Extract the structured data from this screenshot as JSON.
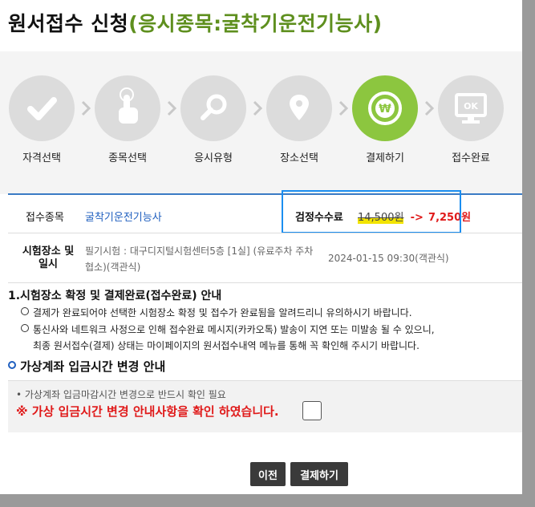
{
  "title": {
    "main": "원서접수 신청",
    "sub": "(응시종목:굴착기운전기능사)"
  },
  "steps": [
    {
      "label": "자격선택",
      "icon": "check-icon",
      "state": "done"
    },
    {
      "label": "종목선택",
      "icon": "hand-pointer-icon",
      "state": "done"
    },
    {
      "label": "응시유형",
      "icon": "magnifier-icon",
      "state": "done"
    },
    {
      "label": "장소선택",
      "icon": "map-pin-icon",
      "state": "done"
    },
    {
      "label": "결제하기",
      "icon": "won-coin-icon",
      "state": "active"
    },
    {
      "label": "접수완료",
      "icon": "monitor-ok-icon",
      "state": "pending"
    }
  ],
  "monitor_ok_text": "OK",
  "exam_info": {
    "subject_label": "접수종목",
    "subject_value": "굴착기운전기능사",
    "fee_label": "검정수수료",
    "fee_original": "14,500원",
    "fee_arrow": "->",
    "fee_discounted": "7,250원",
    "place_label_line1": "시험장소 및",
    "place_label_line2": "일시",
    "place_value_line1": "필기시험 : 대구디지털시험센터5층 [1실] (유료주차 주차",
    "place_value_line2": "협소)(객관식)",
    "datetime": "2024-01-15 09:30(객관식)"
  },
  "notice": {
    "title": "1.시험장소 확정 및 결제완료(접수완료) 안내",
    "item1": "결제가 완료되어야 선택한 시험장소 확정 및 접수가 완료됨을 알려드리니 유의하시기 바랍니다.",
    "item2_line1": "통신사와 네트워크 사정으로 인해 접수완료 메시지(카카오톡) 발송이 지연 또는 미발송 될 수 있으니,",
    "item2_line2": "최종 원서접수(결제) 상태는 마이페이지의 원서접수내역 메뉴를 통해 꼭 확인해 주시기 바랍니다."
  },
  "virtual_account": {
    "title": "가상계좌 입금시간 변경 안내",
    "info": "• 가상계좌 입금마감시간 변경으로 반드시 확인 필요",
    "confirm_text": "※ 가상 입금시간 변경 안내사항을 확인 하였습니다."
  },
  "buttons": {
    "prev": "이전",
    "pay": "결제하기"
  },
  "colors": {
    "accent_green": "#8cc63f",
    "title_green": "#5e8f1e",
    "link_blue": "#1f5fbf",
    "highlight_blue": "#1b8ef0",
    "warning_red": "#e01a1a"
  }
}
